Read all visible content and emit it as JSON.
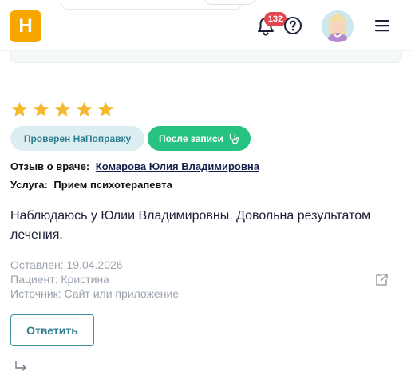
{
  "header": {
    "logo_letter": "Н",
    "notifications_count": "132"
  },
  "review": {
    "rating": 5,
    "rating_max": 5,
    "star_color": "#f5b82e",
    "badges": {
      "verified": "Проверен НаПоправку",
      "after_visit": "После записи"
    },
    "doctor_label": "Отзыв о враче:",
    "doctor_name": "Комарова Юлия Владимировна",
    "service_label": "Услуга:",
    "service_name": "Прием психотерапевта",
    "text": "Наблюдаюсь у Юлии Владимировны. Довольна результатом лечения.",
    "posted": "Оставлен: 19.04.2026",
    "patient": "Пациент: Кристина",
    "source": "Источник: Сайт или приложение",
    "reply_label": "Ответить"
  },
  "colors": {
    "brand": "#f7a600",
    "accent": "#2e7f8f",
    "success": "#26c281",
    "badge": "#e2474e"
  }
}
